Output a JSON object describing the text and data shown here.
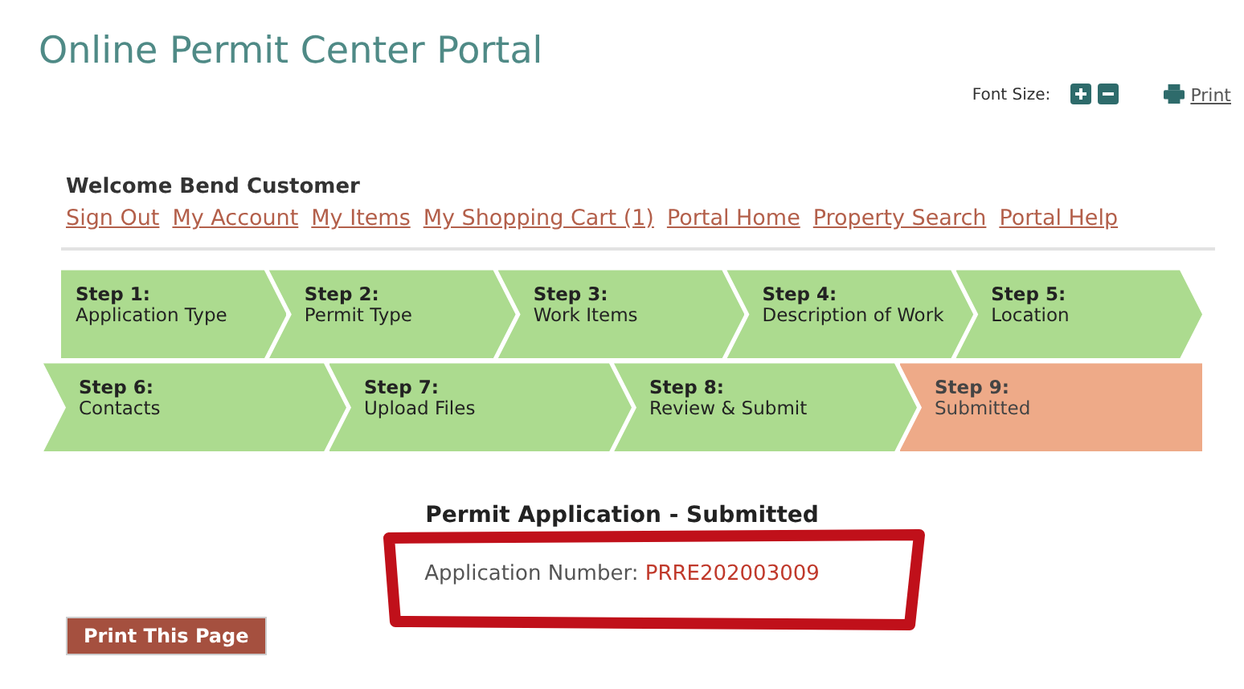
{
  "title": "Online Permit Center Portal",
  "font_size_label": "Font Size:",
  "print_link": "Print",
  "welcome": "Welcome Bend Customer",
  "nav_links": [
    "Sign Out",
    "My Account",
    "My Items",
    "My Shopping Cart (1)",
    "Portal Home",
    "Property Search",
    "Portal Help"
  ],
  "step_rows": [
    [
      {
        "number": "Step 1:",
        "label": "Application Type",
        "selected": false
      },
      {
        "number": "Step 2:",
        "label": "Permit Type",
        "selected": false
      },
      {
        "number": "Step 3:",
        "label": "Work Items",
        "selected": false
      },
      {
        "number": "Step 4:",
        "label": "Description of Work",
        "selected": false
      },
      {
        "number": "Step 5:",
        "label": "Location",
        "selected": false
      }
    ],
    [
      {
        "number": "Step 6:",
        "label": "Contacts",
        "selected": false
      },
      {
        "number": "Step 7:",
        "label": "Upload Files",
        "selected": false
      },
      {
        "number": "Step 8:",
        "label": "Review & Submit",
        "selected": false
      },
      {
        "number": "Step 9:",
        "label": "Submitted",
        "selected": true
      }
    ]
  ],
  "result": {
    "heading": "Permit Application - Submitted",
    "number_label": "Application Number:",
    "number": "PRRE202003009"
  },
  "print_button": "Print This Page"
}
